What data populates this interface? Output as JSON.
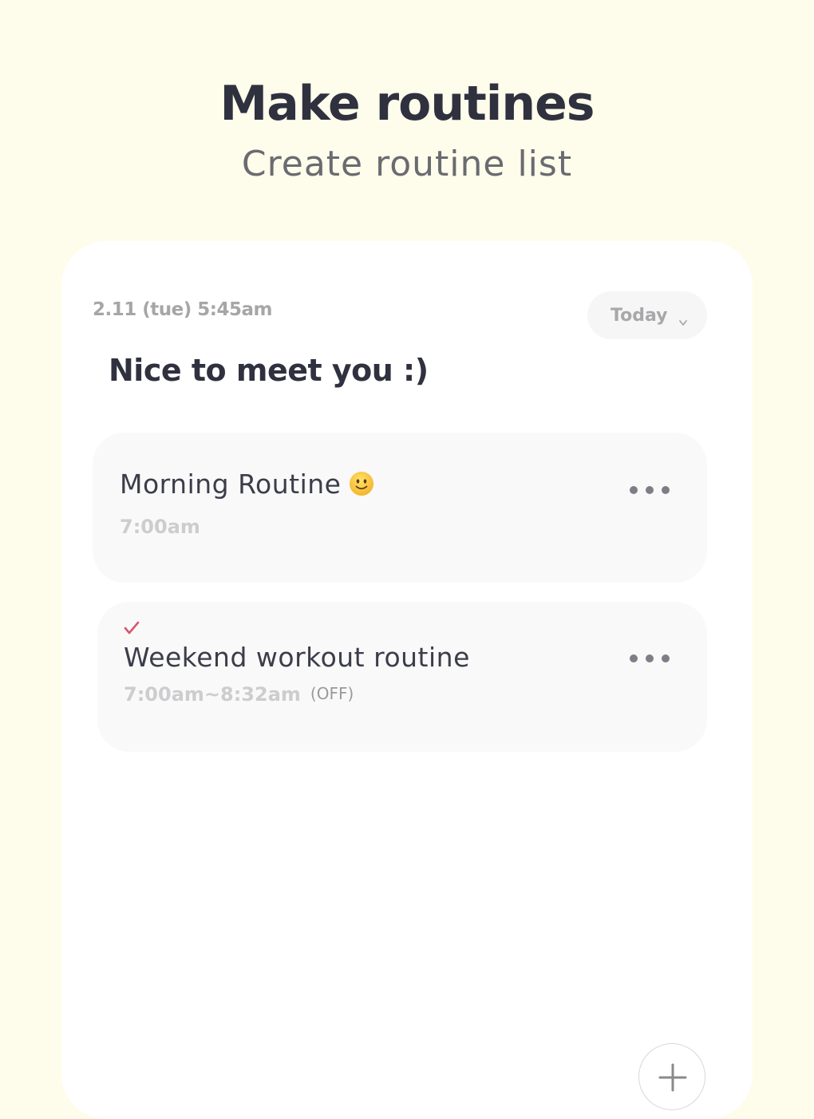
{
  "header": {
    "title": "Make routines",
    "subtitle": "Create routine list"
  },
  "card": {
    "datetime": "2.11 (tue) 5:45am",
    "filter": {
      "label": "Today",
      "icon": "chevron-down-icon"
    },
    "greeting": "Nice to meet you :)",
    "routines": [
      {
        "title": "Morning Routine",
        "emoji": "slightly-smiling-face",
        "time": "7:00am",
        "menu_icon": "more-horizontal-icon"
      },
      {
        "title": "Weekend workout routine",
        "time": "7:00am~8:32am",
        "status": "(OFF)",
        "checked": true,
        "check_color": "#D9576A",
        "menu_icon": "more-horizontal-icon"
      }
    ],
    "add_button_icon": "plus-icon"
  },
  "colors": {
    "background": "#FEFCEB",
    "card": "#FFFFFF",
    "routine_bg": "#F9F9F9",
    "text_dark": "#30313F",
    "text_muted": "#A6A6A8",
    "accent_check": "#D9576A"
  }
}
